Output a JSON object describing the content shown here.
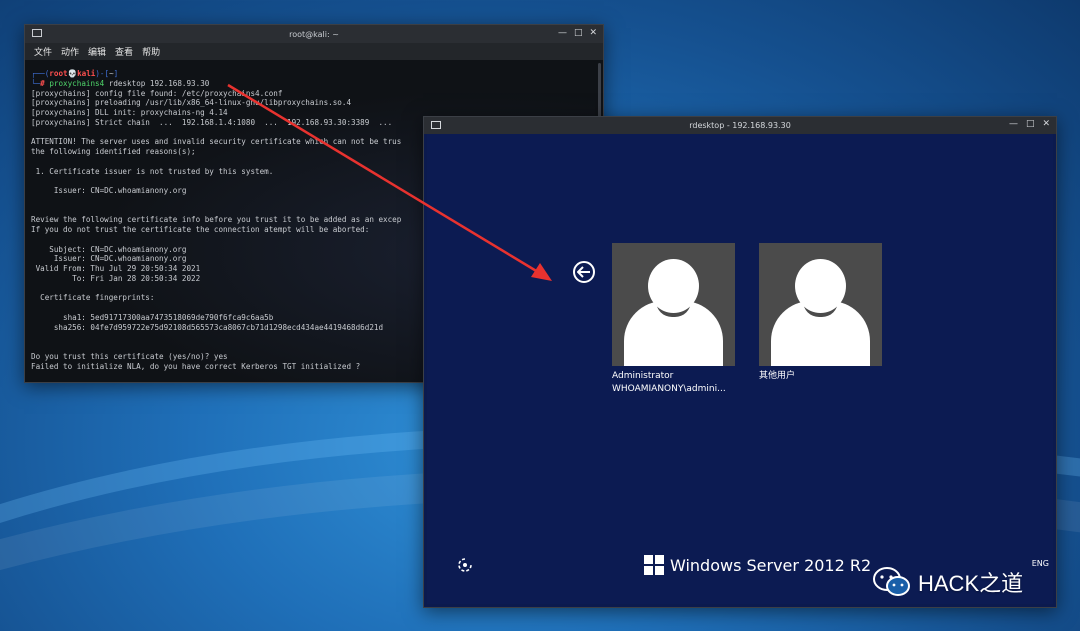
{
  "terminal": {
    "title": "root@kali: ~",
    "menu": [
      "文件",
      "动作",
      "编辑",
      "查看",
      "帮助"
    ],
    "prompt": {
      "user": "root",
      "host": "kali",
      "dir": "~"
    },
    "command": {
      "tool": "proxychains4",
      "rest": " rdesktop 192.168.93.30"
    },
    "lines": [
      "[proxychains] config file found: /etc/proxychains4.conf",
      "[proxychains] preloading /usr/lib/x86_64-linux-gnu/libproxychains.so.4",
      "[proxychains] DLL init: proxychains-ng 4.14",
      "[proxychains] Strict chain  ...  192.168.1.4:1080  ...  192.168.93.30:3389  ...",
      "",
      "ATTENTION! The server uses and invalid security certificate which can not be trus",
      "the following identified reasons(s);",
      "",
      " 1. Certificate issuer is not trusted by this system.",
      "",
      "     Issuer: CN=DC.whoamianony.org",
      "",
      "",
      "Review the following certificate info before you trust it to be added as an excep",
      "If you do not trust the certificate the connection atempt will be aborted:",
      "",
      "    Subject: CN=DC.whoamianony.org",
      "     Issuer: CN=DC.whoamianony.org",
      " Valid From: Thu Jul 29 20:50:34 2021",
      "         To: Fri Jan 28 20:50:34 2022",
      "",
      "  Certificate fingerprints:",
      "",
      "       sha1: 5ed91717300aa7473518069de790f6fca9c6aa5b",
      "     sha256: 04fe7d959722e75d92108d565573ca8067cb71d1298ecd434ae4419468d6d21d",
      "",
      "",
      "Do you trust this certificate (yes/no)? yes",
      "Failed to initialize NLA, do you have correct Kerberos TGT initialized ?"
    ]
  },
  "rdesktop": {
    "title": "rdesktop - 192.168.93.30",
    "users": [
      {
        "name": "Administrator",
        "account": "WHOAMIANONY\\admini..."
      },
      {
        "name": "其他用户"
      }
    ],
    "product": "Windows Server 2012 R2",
    "lang": "ENG"
  },
  "watermark": "HACK之道"
}
